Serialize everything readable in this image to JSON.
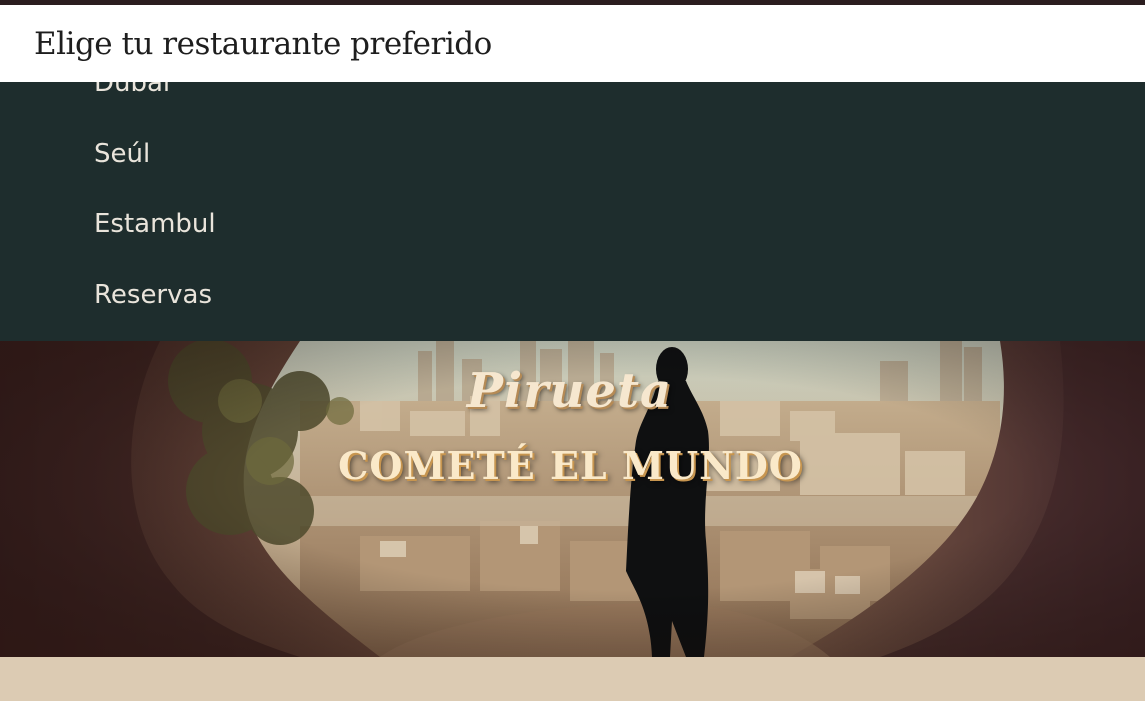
{
  "selector": {
    "label": "Elige tu restaurante preferido"
  },
  "menu": {
    "items": [
      {
        "label": "Dubai"
      },
      {
        "label": "Seúl"
      },
      {
        "label": "Estambul"
      },
      {
        "label": "Reservas"
      }
    ]
  },
  "hero": {
    "brand": "Pirueta",
    "tagline": "COMETÉ EL MUNDO"
  },
  "colors": {
    "menu_background": "#1e2d2d",
    "menu_text": "#e9e4db",
    "hero_text": "#fae9c9",
    "page_background": "#dccbb3"
  }
}
